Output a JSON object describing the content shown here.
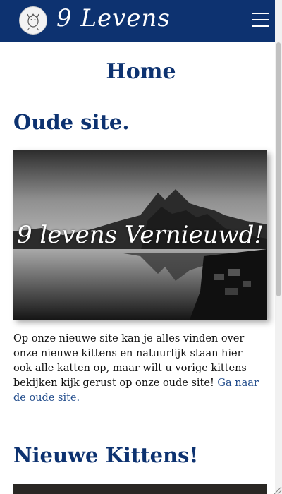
{
  "header": {
    "brand": "9 Levens",
    "menu_icon": "hamburger-menu-icon",
    "logo_icon": "cat-logo-icon",
    "color": "#0d3270"
  },
  "page": {
    "title": "Home"
  },
  "sections": [
    {
      "title": "Oude site.",
      "image_caption": "9 levens Vernieuwd!",
      "text": "Op onze nieuwe site kan je alles vinden over onze nieuwe kittens en natuurlijk staan hier ook alle katten op, maar wilt u vorige kittens bekijken kijk gerust op onze oude site!",
      "link_label": "Ga naar de oude site."
    },
    {
      "title": "Nieuwe Kittens!"
    }
  ]
}
